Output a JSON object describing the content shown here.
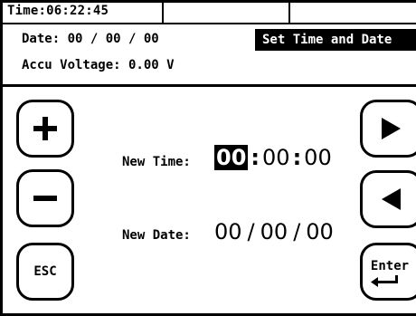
{
  "status": {
    "time": "Time:06:22:45",
    "date": "Date:  00 / 00 / 00",
    "accu_voltage": "Accu Voltage: 0.00 V",
    "screen_title": "Set Time and Date"
  },
  "buttons": {
    "plus": "+",
    "minus": "–",
    "esc": "ESC",
    "next": "▶",
    "prev": "◀",
    "enter": "Enter",
    "enter_glyph": "↵"
  },
  "fields": {
    "time_label": "New Time:",
    "time_hh": "00",
    "time_mm": "00",
    "time_ss": "00",
    "time_sep": ":",
    "date_label": "New Date:",
    "date_dd": "00",
    "date_mm": "00",
    "date_yy": "00",
    "date_sep": "/"
  }
}
